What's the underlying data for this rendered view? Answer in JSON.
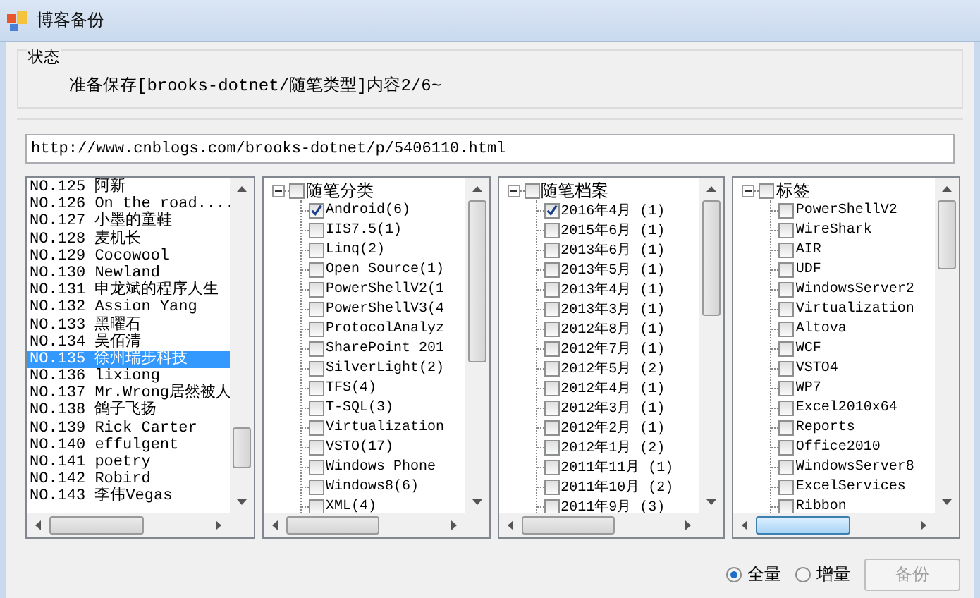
{
  "window": {
    "title": "博客备份"
  },
  "status": {
    "title": "状态",
    "text": "准备保存[brooks-dotnet/随笔类型]内容2/6~"
  },
  "url_field": {
    "value": "http://www.cnblogs.com/brooks-dotnet/p/5406110.html"
  },
  "blog_list": [
    {
      "label": "NO.125 阿新",
      "selected": false
    },
    {
      "label": "NO.126 On the road....",
      "selected": false
    },
    {
      "label": "NO.127 小墨的童鞋",
      "selected": false
    },
    {
      "label": "NO.128 麦机长",
      "selected": false
    },
    {
      "label": "NO.129 Cocowool",
      "selected": false
    },
    {
      "label": "NO.130 Newland",
      "selected": false
    },
    {
      "label": "NO.131 申龙斌的程序人生",
      "selected": false
    },
    {
      "label": "NO.132 Assion Yang",
      "selected": false
    },
    {
      "label": "NO.133 黑曜石",
      "selected": false
    },
    {
      "label": "NO.134 吴佰清",
      "selected": false
    },
    {
      "label": "NO.135 徐州瑞步科技",
      "selected": true
    },
    {
      "label": "NO.136 lixiong",
      "selected": false
    },
    {
      "label": "NO.137 Mr.Wrong居然被人",
      "selected": false
    },
    {
      "label": "NO.138 鸽子飞扬",
      "selected": false
    },
    {
      "label": "NO.139 Rick Carter",
      "selected": false
    },
    {
      "label": "NO.140 effulgent",
      "selected": false
    },
    {
      "label": "NO.141 poetry",
      "selected": false
    },
    {
      "label": "NO.142 Robird",
      "selected": false
    },
    {
      "label": "NO.143 李伟Vegas",
      "selected": false
    }
  ],
  "trees": [
    {
      "label": "随笔分类",
      "checked": false,
      "expanded": true,
      "children": [
        {
          "label": "Android(6)",
          "checked": true
        },
        {
          "label": "IIS7.5(1)",
          "checked": false
        },
        {
          "label": "Linq(2)",
          "checked": false
        },
        {
          "label": "Open Source(1)",
          "checked": false
        },
        {
          "label": "PowerShellV2(1",
          "checked": false
        },
        {
          "label": "PowerShellV3(4",
          "checked": false
        },
        {
          "label": "ProtocolAnalyz",
          "checked": false
        },
        {
          "label": "SharePoint 201",
          "checked": false
        },
        {
          "label": "SilverLight(2)",
          "checked": false
        },
        {
          "label": "TFS(4)",
          "checked": false
        },
        {
          "label": "T-SQL(3)",
          "checked": false
        },
        {
          "label": "Virtualization",
          "checked": false
        },
        {
          "label": "VSTO(17)",
          "checked": false
        },
        {
          "label": "Windows Phone",
          "checked": false
        },
        {
          "label": "Windows8(6)",
          "checked": false
        },
        {
          "label": "XML(4)",
          "checked": false
        }
      ]
    },
    {
      "label": "随笔档案",
      "checked": false,
      "expanded": true,
      "children": [
        {
          "label": "2016年4月 (1)",
          "checked": true
        },
        {
          "label": "2015年6月 (1)",
          "checked": false
        },
        {
          "label": "2013年6月 (1)",
          "checked": false
        },
        {
          "label": "2013年5月 (1)",
          "checked": false
        },
        {
          "label": "2013年4月 (1)",
          "checked": false
        },
        {
          "label": "2013年3月 (1)",
          "checked": false
        },
        {
          "label": "2012年8月 (1)",
          "checked": false
        },
        {
          "label": "2012年7月 (1)",
          "checked": false
        },
        {
          "label": "2012年5月 (2)",
          "checked": false
        },
        {
          "label": "2012年4月 (1)",
          "checked": false
        },
        {
          "label": "2012年3月 (1)",
          "checked": false
        },
        {
          "label": "2012年2月 (1)",
          "checked": false
        },
        {
          "label": "2012年1月 (2)",
          "checked": false
        },
        {
          "label": "2011年11月 (1)",
          "checked": false
        },
        {
          "label": "2011年10月 (2)",
          "checked": false
        },
        {
          "label": "2011年9月 (3)",
          "checked": false
        }
      ]
    },
    {
      "label": "标签",
      "checked": false,
      "expanded": true,
      "children": [
        {
          "label": "PowerShellV2",
          "checked": false
        },
        {
          "label": "WireShark",
          "checked": false
        },
        {
          "label": "AIR",
          "checked": false
        },
        {
          "label": "UDF",
          "checked": false
        },
        {
          "label": "WindowsServer2",
          "checked": false
        },
        {
          "label": "Virtualization",
          "checked": false
        },
        {
          "label": "Altova",
          "checked": false
        },
        {
          "label": "WCF",
          "checked": false
        },
        {
          "label": "VSTO4",
          "checked": false
        },
        {
          "label": "WP7",
          "checked": false
        },
        {
          "label": "Excel2010x64",
          "checked": false
        },
        {
          "label": "Reports",
          "checked": false
        },
        {
          "label": "Office2010",
          "checked": false
        },
        {
          "label": "WindowsServer8",
          "checked": false
        },
        {
          "label": "ExcelServices",
          "checked": false
        },
        {
          "label": "Ribbon",
          "checked": false
        }
      ]
    }
  ],
  "backup_modes": [
    {
      "label": "全量",
      "selected": true
    },
    {
      "label": "增量",
      "selected": false
    }
  ],
  "backup_button": {
    "label": "备份",
    "disabled": true
  }
}
